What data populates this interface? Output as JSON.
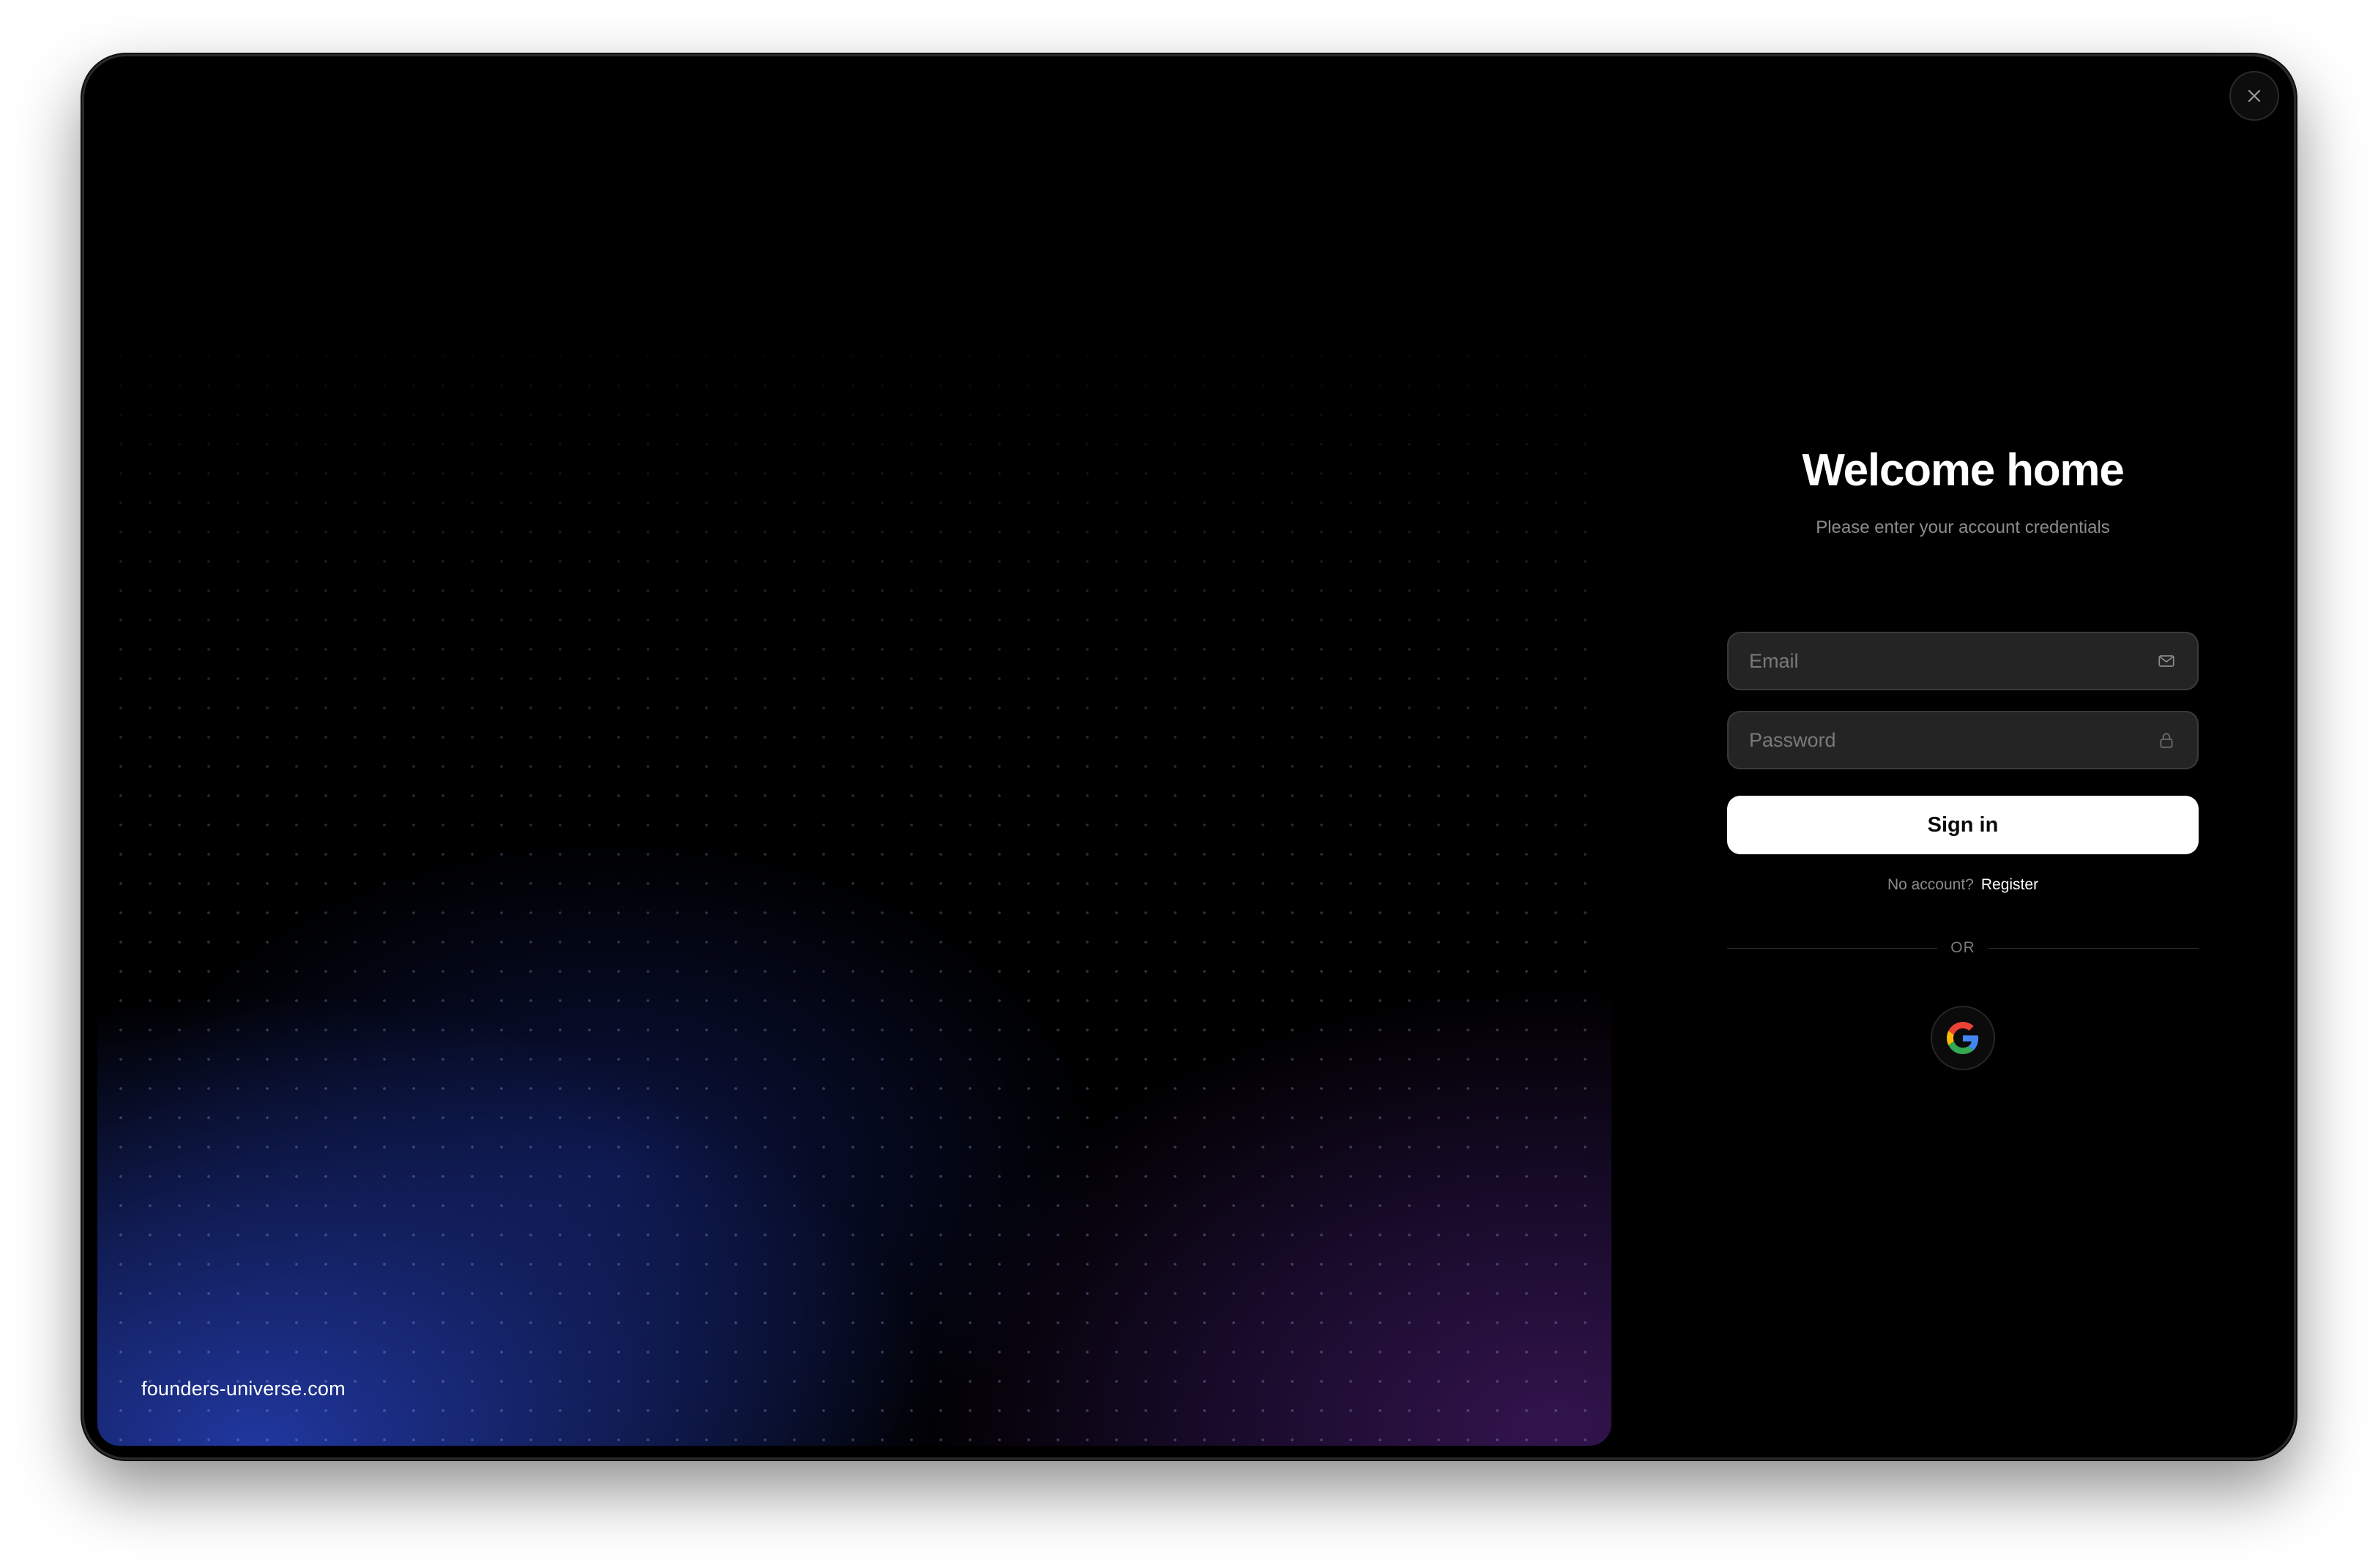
{
  "window": {
    "traffic_lights": [
      "close",
      "minimize",
      "zoom"
    ],
    "close_icon": "close-icon"
  },
  "hero": {
    "domain": "founders-universe.com"
  },
  "login": {
    "title": "Welcome home",
    "subtitle": "Please enter your account credentials",
    "email": {
      "placeholder": "Email",
      "value": "",
      "icon": "mail-icon"
    },
    "password": {
      "placeholder": "Password",
      "value": "",
      "icon": "lock-icon"
    },
    "signin_label": "Sign in",
    "no_account_text": "No account?",
    "register_label": "Register",
    "divider_text": "OR",
    "google_icon": "google-icon"
  },
  "colors": {
    "background": "#000000",
    "accent_blue": "#223aa8",
    "accent_purple": "#381656",
    "button_bg": "#ffffff",
    "field_bg": "#242424",
    "muted_text": "#8c8c8c"
  }
}
